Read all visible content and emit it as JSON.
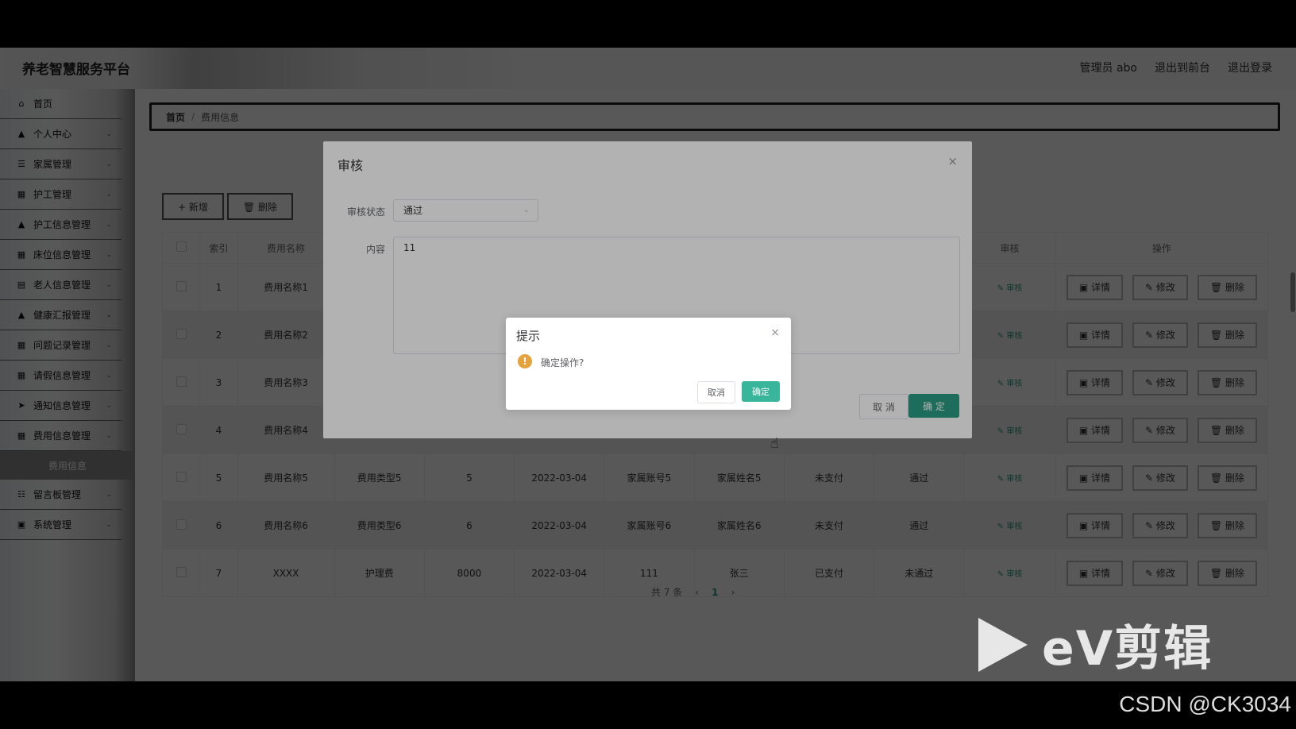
{
  "brand": "养老智慧服务平台",
  "header": {
    "admin": "管理员 abo",
    "to_front": "退出到前台",
    "logout": "退出登录"
  },
  "sidebar": {
    "items": [
      {
        "label": "首页",
        "icon": "home-icon",
        "glyph": "⌂"
      },
      {
        "label": "个人中心",
        "icon": "user-icon",
        "glyph": "▲"
      },
      {
        "label": "家属管理",
        "icon": "list-icon",
        "glyph": "☰"
      },
      {
        "label": "护工管理",
        "icon": "grid-icon",
        "glyph": "▦"
      },
      {
        "label": "护工信息管理",
        "icon": "user-icon",
        "glyph": "▲"
      },
      {
        "label": "床位信息管理",
        "icon": "grid-icon",
        "glyph": "▦"
      },
      {
        "label": "老人信息管理",
        "icon": "clipboard-icon",
        "glyph": "▤"
      },
      {
        "label": "健康汇报管理",
        "icon": "user-icon",
        "glyph": "▲"
      },
      {
        "label": "问题记录管理",
        "icon": "grid-icon",
        "glyph": "▦"
      },
      {
        "label": "请假信息管理",
        "icon": "grid-icon",
        "glyph": "▦"
      },
      {
        "label": "通知信息管理",
        "icon": "send-icon",
        "glyph": "➤"
      },
      {
        "label": "费用信息管理",
        "icon": "grid-icon",
        "glyph": "▦"
      }
    ],
    "sub_active": "费用信息",
    "items_after": [
      {
        "label": "留言板管理",
        "icon": "sliders-icon",
        "glyph": "☷"
      },
      {
        "label": "系统管理",
        "icon": "chart-icon",
        "glyph": "▣"
      }
    ]
  },
  "breadcrumb": {
    "home": "首页",
    "sep": "/",
    "current": "费用信息"
  },
  "toolbar": {
    "add": "+ 新增",
    "delete": "🗑 删除"
  },
  "table": {
    "headers": [
      "",
      "索引",
      "费用名称",
      "",
      "",
      "",
      "",
      "",
      "",
      "",
      "审核",
      "操作"
    ],
    "rows": [
      [
        "1",
        "费用名称1",
        "",
        "",
        "",
        "",
        "",
        "",
        ""
      ],
      [
        "2",
        "费用名称2",
        "",
        "",
        "",
        "",
        "",
        "",
        ""
      ],
      [
        "3",
        "费用名称3",
        "",
        "",
        "",
        "",
        "",
        "",
        ""
      ],
      [
        "4",
        "费用名称4",
        "",
        "",
        "",
        "",
        "",
        "",
        ""
      ],
      [
        "5",
        "费用名称5",
        "费用类型5",
        "5",
        "2022-03-04",
        "家属账号5",
        "家属姓名5",
        "未支付",
        "通过"
      ],
      [
        "6",
        "费用名称6",
        "费用类型6",
        "6",
        "2022-03-04",
        "家属账号6",
        "家属姓名6",
        "未支付",
        "通过"
      ],
      [
        "7",
        "XXXX",
        "护理费",
        "8000",
        "2022-03-04",
        "111",
        "张三",
        "已支付",
        "未通过"
      ]
    ],
    "audit_link": "✎ 审核",
    "op_detail": "▣ 详情",
    "op_edit": "✎ 修改",
    "op_delete": "🗑 删除"
  },
  "pager": {
    "total": "共 7 条",
    "prev": "‹",
    "page": "1",
    "next": "›"
  },
  "audit_dialog": {
    "title": "审核",
    "close": "×",
    "status_label": "审核状态",
    "status_value": "通过",
    "content_label": "内容",
    "content_value": "11",
    "cancel": "取 消",
    "ok": "确 定"
  },
  "confirm_box": {
    "title": "提示",
    "close": "×",
    "icon": "!",
    "message": "确定操作?",
    "cancel": "取消",
    "ok": "确定"
  },
  "watermark": {
    "text": "eV剪辑"
  },
  "credit": "CSDN @CK3034"
}
